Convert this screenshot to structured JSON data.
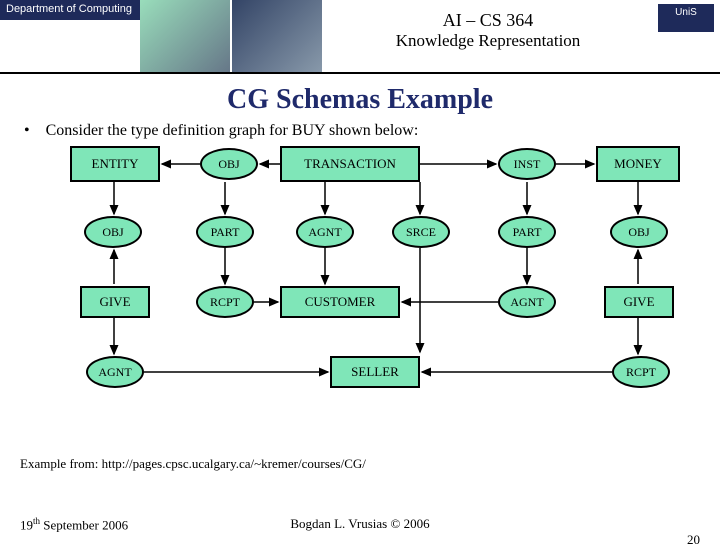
{
  "header": {
    "dept": "Department of Computing",
    "title": "AI – CS 364",
    "subtitle": "Knowledge Representation",
    "uni": "UniS"
  },
  "main_title": "CG Schemas Example",
  "bullet": "Consider the type definition graph for BUY shown below:",
  "nodes": {
    "entity": "ENTITY",
    "transaction": "TRANSACTION",
    "money": "MONEY",
    "giveL": "GIVE",
    "customer": "CUSTOMER",
    "giveR": "GIVE",
    "seller": "SELLER",
    "obj1": "OBJ",
    "inst": "INST",
    "obj2": "OBJ",
    "part1": "PART",
    "agnt1": "AGNT",
    "srce": "SRCE",
    "part2": "PART",
    "obj3": "OBJ",
    "rcpt1": "RCPT",
    "agnt2": "AGNT",
    "agnt3": "AGNT",
    "rcpt2": "RCPT"
  },
  "source_line": "Example from: http://pages.cpsc.ucalgary.ca/~kremer/courses/CG/",
  "footer": {
    "date_html": "19<span class='sup'>th</span> September 2006",
    "center": "Bogdan L. Vrusias © 2006",
    "page": "20"
  }
}
